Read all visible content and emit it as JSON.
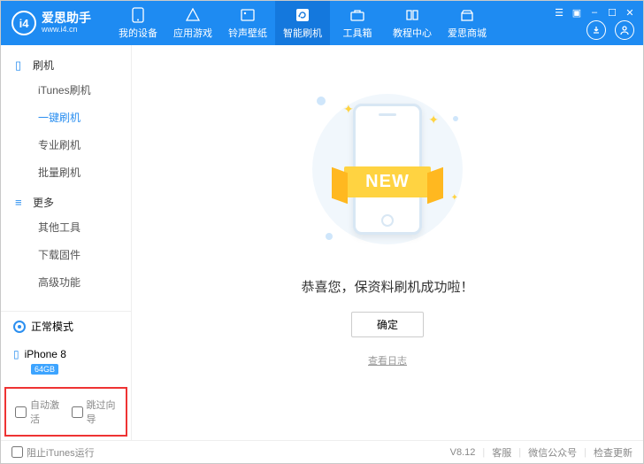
{
  "app": {
    "name": "爱思助手",
    "url": "www.i4.cn"
  },
  "nav": [
    {
      "label": "我的设备"
    },
    {
      "label": "应用游戏"
    },
    {
      "label": "铃声壁纸"
    },
    {
      "label": "智能刷机"
    },
    {
      "label": "工具箱"
    },
    {
      "label": "教程中心"
    },
    {
      "label": "爱思商城"
    }
  ],
  "sidebar": {
    "group1": {
      "title": "刷机"
    },
    "items1": [
      {
        "label": "iTunes刷机"
      },
      {
        "label": "一键刷机"
      },
      {
        "label": "专业刷机"
      },
      {
        "label": "批量刷机"
      }
    ],
    "group2": {
      "title": "更多"
    },
    "items2": [
      {
        "label": "其他工具"
      },
      {
        "label": "下载固件"
      },
      {
        "label": "高级功能"
      }
    ],
    "mode": "正常模式",
    "device": "iPhone 8",
    "storage": "64GB",
    "auto_activate": "自动激活",
    "skip_guide": "跳过向导"
  },
  "main": {
    "ribbon": "NEW",
    "message": "恭喜您，保资料刷机成功啦！",
    "ok": "确定",
    "log": "查看日志"
  },
  "footer": {
    "block_itunes": "阻止iTunes运行",
    "version": "V8.12",
    "links": [
      {
        "label": "客服"
      },
      {
        "label": "微信公众号"
      },
      {
        "label": "检查更新"
      }
    ]
  }
}
